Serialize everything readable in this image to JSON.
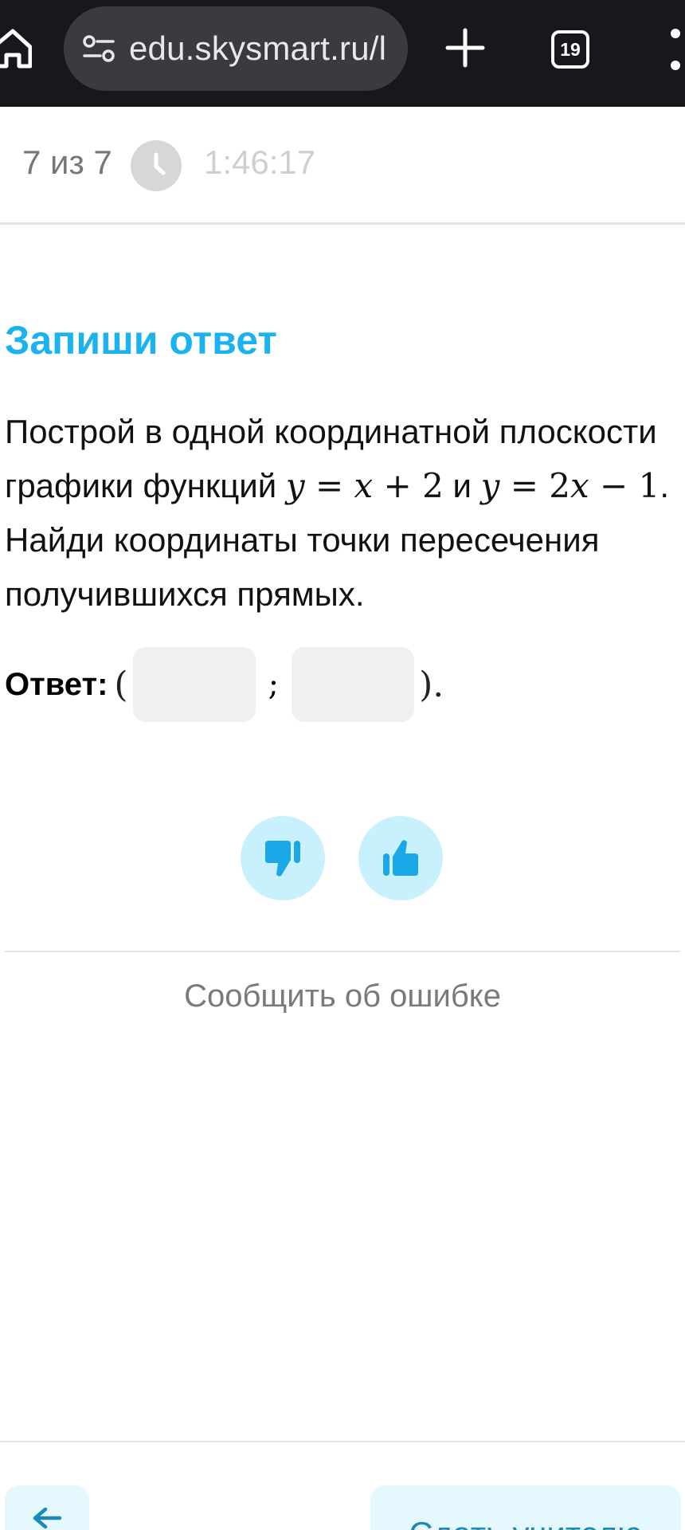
{
  "browser": {
    "url": "edu.skysmart.ru/l",
    "tab_count": "19"
  },
  "progress": {
    "counter": "7 из 7",
    "timer": "1:46:17"
  },
  "task": {
    "title": "Запиши ответ",
    "text_part1": "Построй в одной координатной плоскости графики функций ",
    "eq1_lhs": "y",
    "eq1_rhs_var": "x",
    "eq1_rhs_rest": " + 2",
    "text_and": " и",
    "eq2_lhs": "y",
    "eq2_coef": "2",
    "eq2_var": "x",
    "eq2_rest": " − 1",
    "text_part2": ". Найди координаты точки пересечения получившихся прямых."
  },
  "answer": {
    "label": "Ответ:",
    "open_paren": "(",
    "separator": ";",
    "close_paren": ").",
    "x_value": "",
    "y_value": ""
  },
  "report": {
    "label": "Сообщить об ошибке"
  },
  "footer": {
    "submit_label": "Сдать учителю"
  },
  "colors": {
    "accent": "#1ab3ef",
    "reaction_bg": "#c9f1fd",
    "icon_blue": "#1aa8e8"
  }
}
